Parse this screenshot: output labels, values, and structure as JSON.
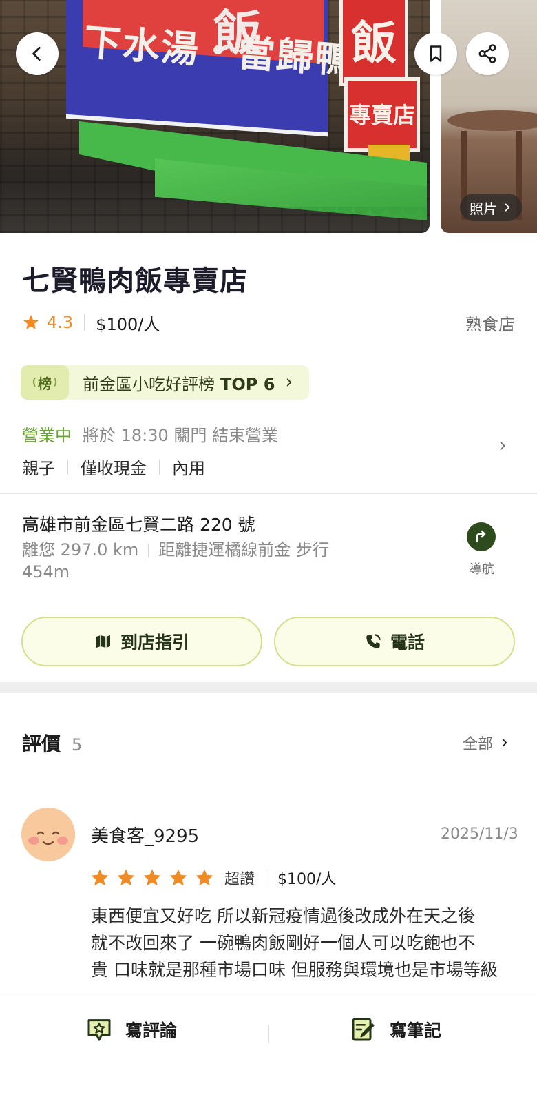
{
  "hero": {
    "photos_label": "照片",
    "sign_line": "下水湯・當歸鴨",
    "sign_top": "飯",
    "sign_v1": "飯",
    "sign_v2": "專賣店"
  },
  "store": {
    "name": "七賢鴨肉飯專賣店",
    "rating": "4.3",
    "price": "$100/人",
    "category": "熟食店",
    "rank_badge": "榜",
    "rank_text": "前金區小吃好評榜",
    "rank_top": "TOP 6",
    "status": "營業中",
    "hours": "將於 18:30 關門 結束營業",
    "tags": [
      "親子",
      "僅收現金",
      "內用"
    ],
    "address": "高雄市前金區七賢二路 220 號",
    "distance": "離您 297.0 km",
    "transit": "距離捷運橘線前金 步行 454m",
    "nav_label": "導航",
    "directions_label": "到店指引",
    "call_label": "電話"
  },
  "reviews": {
    "title": "評價",
    "count": "5",
    "all_label": "全部",
    "items": [
      {
        "author": "美食客_9295",
        "date": "2025/11/3",
        "stars": 5,
        "star_word": "超讚",
        "price": "$100/人",
        "lines": [
          "東西便宜又好吃 所以新冠疫情過後改成外在天之後",
          "就不改回來了 一碗鴨肉飯剛好一個人可以吃飽也不",
          "貴 口味就是那種市場口味 但服務與環境也是市場等級"
        ]
      }
    ]
  },
  "bottom_bar": {
    "write_review": "寫評論",
    "write_note": "寫筆記"
  },
  "colors": {
    "accent_green": "#68a530",
    "star_orange": "#f08a24",
    "nav_green": "#2d4b1d",
    "pill_bg": "#fbfde9"
  }
}
